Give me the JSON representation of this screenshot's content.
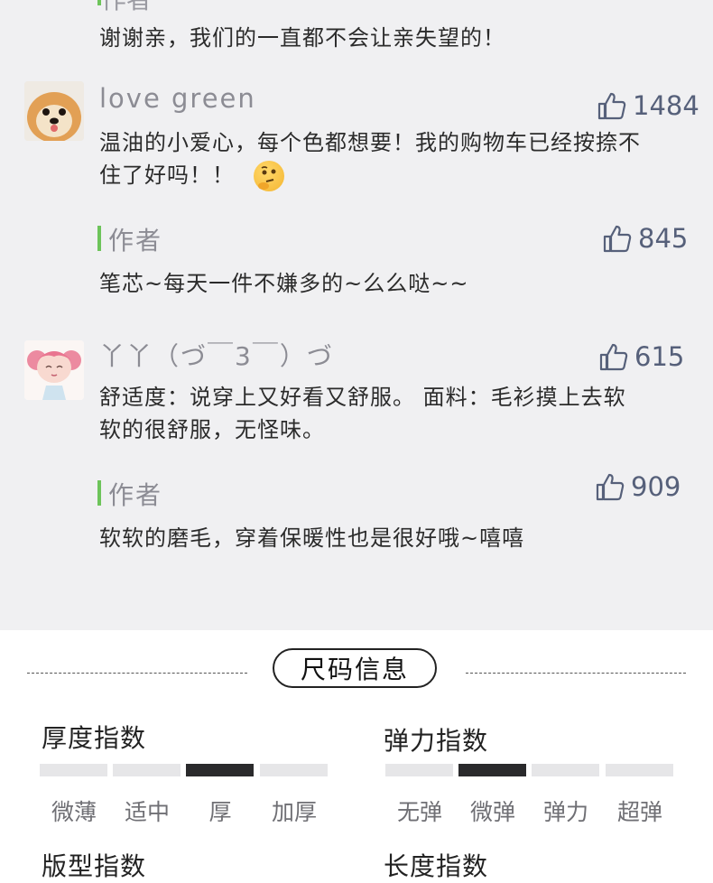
{
  "comments": {
    "cut_author_label": "作者",
    "reply0": {
      "text": "谢谢亲，我们的一直都不会让亲失望的！"
    },
    "items": [
      {
        "username": "love green",
        "likes": "1484",
        "text_line1": "温油的小爱心，每个色都想要！我的购物车已经按捺不",
        "text_line2": "住了好吗！！",
        "emoji": "thinking-face",
        "reply": {
          "label": "作者",
          "likes": "845",
          "text": "笔芯~每天一件不嫌多的~么么哒~~"
        }
      },
      {
        "username": "丫丫（づ￣3￣）づ",
        "likes": "615",
        "text_line1": "舒适度：说穿上又好看又舒服。 面料：毛衫摸上去软",
        "text_line2": "软的很舒服，无怪味。",
        "reply": {
          "label": "作者",
          "likes": "909",
          "text": "软软的磨毛，穿着保暖性也是很好哦~嘻嘻"
        }
      }
    ]
  },
  "size_info": {
    "title": "尺码信息",
    "thickness": {
      "title": "厚度指数",
      "options": [
        "微薄",
        "适中",
        "厚",
        "加厚"
      ],
      "selected_index": 2
    },
    "elasticity": {
      "title": "弹力指数",
      "options": [
        "无弹",
        "微弹",
        "弹力",
        "超弹"
      ],
      "selected_index": 1
    },
    "fit_title": "版型指数",
    "length_title": "长度指数"
  },
  "colors": {
    "background": "#f0f0f2",
    "accent_green": "#6dc45a",
    "like_icon": "#56607a",
    "selected_segment": "#2a2a2c"
  }
}
